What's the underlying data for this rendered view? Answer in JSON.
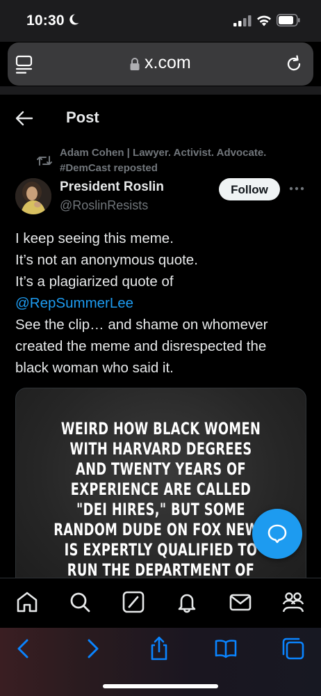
{
  "status_bar": {
    "time": "10:30"
  },
  "browser": {
    "url": "x.com"
  },
  "header": {
    "title": "Post"
  },
  "repost": {
    "text": "Adam Cohen | Lawyer. Activist. Advocate. #DemCast reposted"
  },
  "author": {
    "display_name": "President Roslin",
    "handle": "@RoslinResists",
    "follow_label": "Follow"
  },
  "post": {
    "lines": [
      "I keep seeing this meme.",
      "It’s not an anonymous quote.",
      "It’s a plagiarized quote of",
      "@RepSummerLee",
      "See the clip… and shame on whomever",
      "created the meme and disrespected the",
      "black woman who said it."
    ],
    "mention": "@RepSummerLee"
  },
  "media": {
    "meme_lines": [
      "WEIRD HOW BLACK WOMEN",
      "WITH HARVARD DEGREES",
      "AND TWENTY YEARS OF",
      "EXPERIENCE ARE CALLED",
      "\"DEI HIRES,\" BUT SOME",
      "RANDOM DUDE ON FOX NEWS",
      "IS EXPERTLY QUALIFIED TO",
      "RUN THE DEPARTMENT OF"
    ]
  },
  "bottom_nav": [
    "home-icon",
    "search-icon",
    "grok-icon",
    "notifications-icon",
    "messages-icon",
    "communities-icon"
  ],
  "safari_toolbar": [
    "back-icon",
    "forward-icon",
    "share-icon",
    "bookmarks-icon",
    "tabs-icon"
  ],
  "colors": {
    "accent": "#1d9bf0",
    "text": "#e7e9ea",
    "muted": "#71767b",
    "safari_blue": "#0a84ff"
  }
}
